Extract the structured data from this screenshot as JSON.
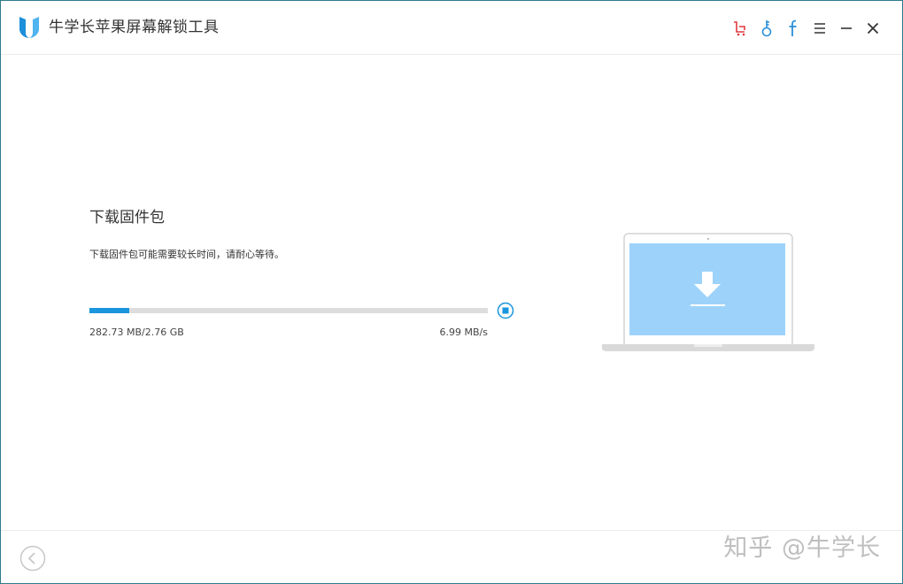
{
  "app": {
    "title": "牛学长苹果屏幕解锁工具"
  },
  "titlebar": {
    "icons": [
      "cart-icon",
      "key-icon",
      "facebook-icon",
      "menu-icon",
      "minimize-icon",
      "close-icon"
    ],
    "icon_colors": {
      "cart": "#e0393e",
      "key": "#2a8fd8",
      "facebook": "#2a8fd8",
      "default": "#333333"
    },
    "facebook_glyph": "f"
  },
  "main": {
    "title": "下载固件包",
    "description": "下载固件包可能需要较长时间，请耐心等待。",
    "progress": {
      "fraction": 0.1,
      "downloaded_label": "282.73 MB/2.76 GB",
      "speed_label": "6.99 MB/s",
      "color": "#1a96de",
      "track_color": "#dddddd"
    },
    "illustration": "laptop-download-illustration",
    "screen_color": "#9dd3fb"
  },
  "footer": {
    "back_icon": "back-arrow-icon",
    "watermark": "知乎 @牛学长"
  }
}
